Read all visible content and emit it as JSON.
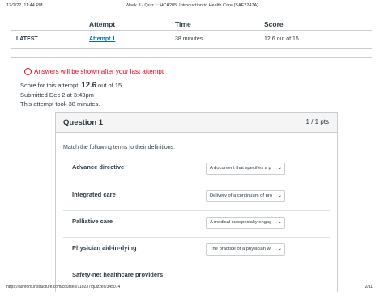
{
  "print_header": {
    "date": "12/2/22, 11:44 PM",
    "title": "Week 3 - Quiz 1: HCA205: Introduction to Health Care (SAE2247A)"
  },
  "attempts_table": {
    "headers": [
      "",
      "Attempt",
      "Time",
      "Score"
    ],
    "rows": [
      {
        "label": "LATEST",
        "attempt": "Attempt 1",
        "time": "38 minutes",
        "score": "12.6 out of 15"
      }
    ]
  },
  "notice": {
    "icon": "exclamation-circle-icon",
    "text": "Answers will be shown after your last attempt",
    "color": "#e0061f"
  },
  "summary": {
    "score_prefix": "Score for this attempt: ",
    "score_value": "12.6",
    "score_suffix": " out of 15",
    "submitted": "Submitted Dec 2 at 3:43pm",
    "duration": "This attempt took 38 minutes."
  },
  "question": {
    "title": "Question 1",
    "points": "1 / 1 pts",
    "prompt": "Match the following terms to their definitions:",
    "matches": [
      {
        "term": "Advance directive",
        "selected": "A document that specifies a p"
      },
      {
        "term": "Integrated care",
        "selected": "Delivery of a continuum of pro"
      },
      {
        "term": "Palliative care",
        "selected": "A medical subspecialty engag"
      },
      {
        "term": "Physician aid-in-dying",
        "selected": "The practice of a physician w"
      },
      {
        "term": "Safety-net healthcare providers",
        "selected": ""
      }
    ]
  },
  "print_footer": {
    "url": "https://ashford.instructure.com/courses/110237/quizzes/345074",
    "page": "2/11"
  },
  "colors": {
    "link": "#0770a3",
    "warning": "#e0061f",
    "text": "#2d3b45",
    "border": "#c7cdd1"
  }
}
